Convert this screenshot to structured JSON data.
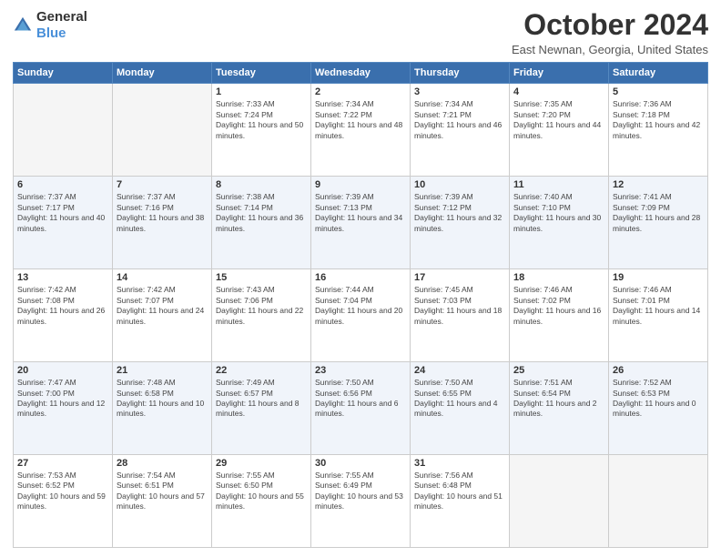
{
  "logo": {
    "general": "General",
    "blue": "Blue"
  },
  "title": {
    "month": "October 2024",
    "location": "East Newnan, Georgia, United States"
  },
  "headers": [
    "Sunday",
    "Monday",
    "Tuesday",
    "Wednesday",
    "Thursday",
    "Friday",
    "Saturday"
  ],
  "weeks": [
    [
      {
        "day": "",
        "detail": ""
      },
      {
        "day": "",
        "detail": ""
      },
      {
        "day": "1",
        "detail": "Sunrise: 7:33 AM\nSunset: 7:24 PM\nDaylight: 11 hours and 50 minutes."
      },
      {
        "day": "2",
        "detail": "Sunrise: 7:34 AM\nSunset: 7:22 PM\nDaylight: 11 hours and 48 minutes."
      },
      {
        "day": "3",
        "detail": "Sunrise: 7:34 AM\nSunset: 7:21 PM\nDaylight: 11 hours and 46 minutes."
      },
      {
        "day": "4",
        "detail": "Sunrise: 7:35 AM\nSunset: 7:20 PM\nDaylight: 11 hours and 44 minutes."
      },
      {
        "day": "5",
        "detail": "Sunrise: 7:36 AM\nSunset: 7:18 PM\nDaylight: 11 hours and 42 minutes."
      }
    ],
    [
      {
        "day": "6",
        "detail": "Sunrise: 7:37 AM\nSunset: 7:17 PM\nDaylight: 11 hours and 40 minutes."
      },
      {
        "day": "7",
        "detail": "Sunrise: 7:37 AM\nSunset: 7:16 PM\nDaylight: 11 hours and 38 minutes."
      },
      {
        "day": "8",
        "detail": "Sunrise: 7:38 AM\nSunset: 7:14 PM\nDaylight: 11 hours and 36 minutes."
      },
      {
        "day": "9",
        "detail": "Sunrise: 7:39 AM\nSunset: 7:13 PM\nDaylight: 11 hours and 34 minutes."
      },
      {
        "day": "10",
        "detail": "Sunrise: 7:39 AM\nSunset: 7:12 PM\nDaylight: 11 hours and 32 minutes."
      },
      {
        "day": "11",
        "detail": "Sunrise: 7:40 AM\nSunset: 7:10 PM\nDaylight: 11 hours and 30 minutes."
      },
      {
        "day": "12",
        "detail": "Sunrise: 7:41 AM\nSunset: 7:09 PM\nDaylight: 11 hours and 28 minutes."
      }
    ],
    [
      {
        "day": "13",
        "detail": "Sunrise: 7:42 AM\nSunset: 7:08 PM\nDaylight: 11 hours and 26 minutes."
      },
      {
        "day": "14",
        "detail": "Sunrise: 7:42 AM\nSunset: 7:07 PM\nDaylight: 11 hours and 24 minutes."
      },
      {
        "day": "15",
        "detail": "Sunrise: 7:43 AM\nSunset: 7:06 PM\nDaylight: 11 hours and 22 minutes."
      },
      {
        "day": "16",
        "detail": "Sunrise: 7:44 AM\nSunset: 7:04 PM\nDaylight: 11 hours and 20 minutes."
      },
      {
        "day": "17",
        "detail": "Sunrise: 7:45 AM\nSunset: 7:03 PM\nDaylight: 11 hours and 18 minutes."
      },
      {
        "day": "18",
        "detail": "Sunrise: 7:46 AM\nSunset: 7:02 PM\nDaylight: 11 hours and 16 minutes."
      },
      {
        "day": "19",
        "detail": "Sunrise: 7:46 AM\nSunset: 7:01 PM\nDaylight: 11 hours and 14 minutes."
      }
    ],
    [
      {
        "day": "20",
        "detail": "Sunrise: 7:47 AM\nSunset: 7:00 PM\nDaylight: 11 hours and 12 minutes."
      },
      {
        "day": "21",
        "detail": "Sunrise: 7:48 AM\nSunset: 6:58 PM\nDaylight: 11 hours and 10 minutes."
      },
      {
        "day": "22",
        "detail": "Sunrise: 7:49 AM\nSunset: 6:57 PM\nDaylight: 11 hours and 8 minutes."
      },
      {
        "day": "23",
        "detail": "Sunrise: 7:50 AM\nSunset: 6:56 PM\nDaylight: 11 hours and 6 minutes."
      },
      {
        "day": "24",
        "detail": "Sunrise: 7:50 AM\nSunset: 6:55 PM\nDaylight: 11 hours and 4 minutes."
      },
      {
        "day": "25",
        "detail": "Sunrise: 7:51 AM\nSunset: 6:54 PM\nDaylight: 11 hours and 2 minutes."
      },
      {
        "day": "26",
        "detail": "Sunrise: 7:52 AM\nSunset: 6:53 PM\nDaylight: 11 hours and 0 minutes."
      }
    ],
    [
      {
        "day": "27",
        "detail": "Sunrise: 7:53 AM\nSunset: 6:52 PM\nDaylight: 10 hours and 59 minutes."
      },
      {
        "day": "28",
        "detail": "Sunrise: 7:54 AM\nSunset: 6:51 PM\nDaylight: 10 hours and 57 minutes."
      },
      {
        "day": "29",
        "detail": "Sunrise: 7:55 AM\nSunset: 6:50 PM\nDaylight: 10 hours and 55 minutes."
      },
      {
        "day": "30",
        "detail": "Sunrise: 7:55 AM\nSunset: 6:49 PM\nDaylight: 10 hours and 53 minutes."
      },
      {
        "day": "31",
        "detail": "Sunrise: 7:56 AM\nSunset: 6:48 PM\nDaylight: 10 hours and 51 minutes."
      },
      {
        "day": "",
        "detail": ""
      },
      {
        "day": "",
        "detail": ""
      }
    ]
  ]
}
